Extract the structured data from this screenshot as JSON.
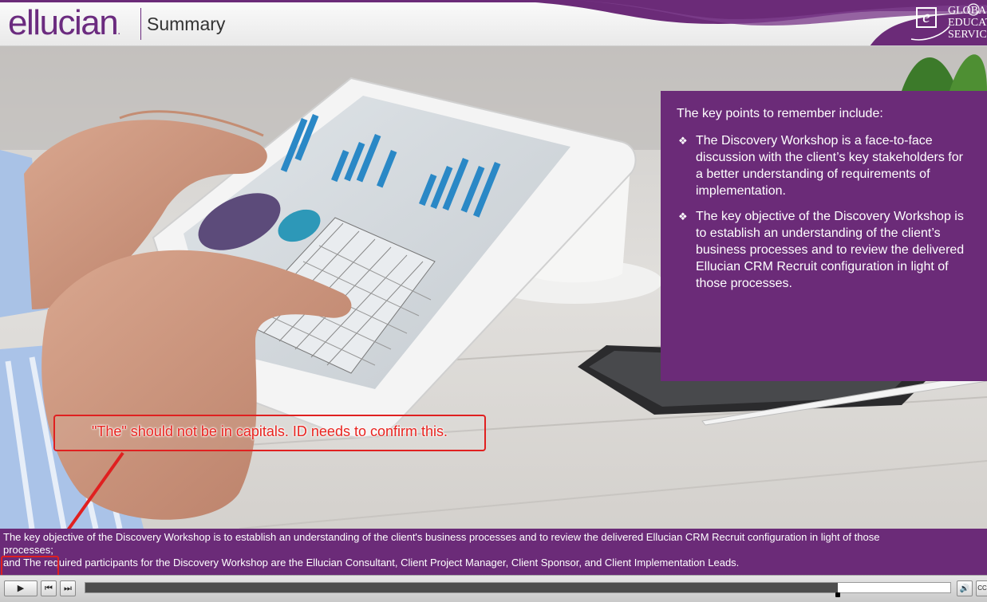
{
  "header": {
    "logo_text": "ellucian",
    "logo_mark": ".",
    "title": "Summary",
    "ges_logo": {
      "letter": "e",
      "lines": [
        "GLOBAL",
        "EDUCATION",
        "SERVICES"
      ]
    }
  },
  "panel": {
    "intro": "The key points to remember include:",
    "bullet_glyph": "❖",
    "points": [
      "The Discovery Workshop is a face-to-face discussion with the client’s key stakeholders for a better understanding of requirements of implementation.",
      "The key objective of the Discovery Workshop is to establish an understanding of the client’s business processes and to review the delivered Ellucian CRM Recruit configuration in light of those processes."
    ]
  },
  "annotation": {
    "text": "\"The\" should not be in capitals. ID needs to confirm this.",
    "color": "#e8231f"
  },
  "captions": {
    "line1": "The key objective of the Discovery Workshop is to establish an understanding of the client's business processes and to review the delivered Ellucian CRM Recruit configuration in light of those processes;",
    "line2": "and The required participants for the Discovery Workshop are the Ellucian Consultant, Client Project Manager, Client Sponsor, and Client Implementation Leads."
  },
  "player": {
    "play_icon": "▶",
    "rewind_icon": "⏮",
    "next_icon": "⏭",
    "volume_icon": "🔊",
    "cc_label": "CC",
    "progress_fraction": 0.87
  },
  "colors": {
    "brand_purple": "#6b2b78",
    "annotation_red": "#e02020"
  }
}
